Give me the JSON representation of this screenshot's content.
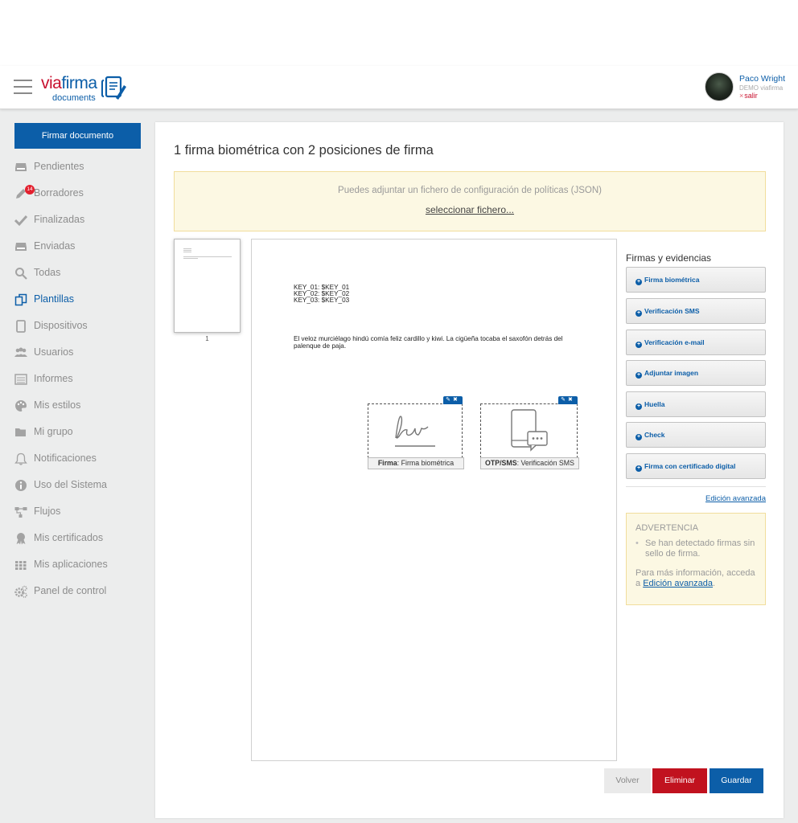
{
  "header": {
    "logo": {
      "via": "via",
      "firma": "firma",
      "sub": "documents"
    },
    "user": {
      "name": "Paco Wright",
      "org": "DEMO viafirma",
      "exit_x": "×",
      "exit": "salir"
    }
  },
  "sidebar": {
    "sign_button": "Firmar documento",
    "items": [
      {
        "label": "Pendientes",
        "icon": "inbox-icon"
      },
      {
        "label": "Borradores",
        "icon": "pencil-icon",
        "badge": "14"
      },
      {
        "label": "Finalizadas",
        "icon": "check-icon"
      },
      {
        "label": "Enviadas",
        "icon": "inbox-icon"
      },
      {
        "label": "Todas",
        "icon": "search-icon"
      },
      {
        "label": "Plantillas",
        "icon": "copy-icon",
        "active": true
      },
      {
        "label": "Dispositivos",
        "icon": "tablet-icon"
      },
      {
        "label": "Usuarios",
        "icon": "users-icon"
      },
      {
        "label": "Informes",
        "icon": "report-icon"
      },
      {
        "label": "Mis estilos",
        "icon": "palette-icon"
      },
      {
        "label": "Mi grupo",
        "icon": "folder-icon"
      },
      {
        "label": "Notificaciones",
        "icon": "bell-icon"
      },
      {
        "label": "Uso del Sistema",
        "icon": "info-icon"
      },
      {
        "label": "Flujos",
        "icon": "flow-icon"
      },
      {
        "label": "Mis certificados",
        "icon": "certificate-icon"
      },
      {
        "label": "Mis aplicaciones",
        "icon": "apps-icon"
      },
      {
        "label": "Panel de control",
        "icon": "gears-icon"
      }
    ]
  },
  "main": {
    "title": "1 firma biométrica con 2 posiciones de firma",
    "notice": {
      "text": "Puedes adjuntar un fichero de configuración de políticas (JSON)",
      "link": "seleccionar fichero..."
    },
    "thumbnail": {
      "page_number": "1"
    },
    "document": {
      "keys": [
        "KEY_01: $KEY_01",
        "KEY_02: $KEY_02",
        "KEY_03: $KEY_03"
      ],
      "text": "El veloz murciélago hindú comía feliz cardillo y kiwi. La cigüeña tocaba el saxofón detrás del palenque de paja."
    },
    "signature_boxes": [
      {
        "kind": "Firma",
        "label": ": Firma biométrica",
        "tools": "✎✖"
      },
      {
        "kind": "OTP/SMS",
        "label": ": Verificación SMS",
        "tools": "✎✖"
      }
    ]
  },
  "evidences": {
    "title": "Firmas y evidencias",
    "buttons": [
      "Firma biométrica",
      "Verificación SMS",
      "Verificación e-mail",
      "Adjuntar imagen",
      "Huella",
      "Check",
      "Firma con certificado digital"
    ],
    "plus_glyph": "+",
    "advanced_link": "Edición avanzada",
    "warning": {
      "title": "ADVERTENCIA",
      "item": "Se han detectado firmas sin sello de firma.",
      "more": "Para más información, acceda a ",
      "link": "Edición avanzada",
      "end": "."
    }
  },
  "actions": {
    "back": "Volver",
    "delete": "Eliminar",
    "save": "Guardar"
  },
  "colors": {
    "brand_blue": "#0c5ea8",
    "brand_red": "#c8102e",
    "delete_red": "#c1121f",
    "warning_bg": "#fcf8e3"
  }
}
